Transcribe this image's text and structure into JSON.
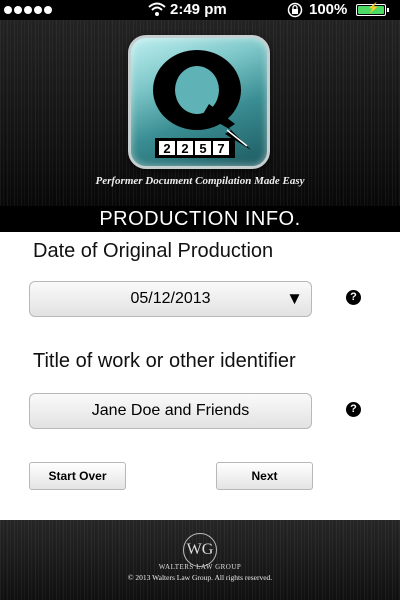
{
  "status_bar": {
    "time": "2:49 pm",
    "battery_percent": "100%",
    "battery_level": 1.0,
    "signal_bars": 5
  },
  "header": {
    "logo": {
      "letter": "Q",
      "counter_digits": [
        "2",
        "2",
        "5",
        "7"
      ]
    },
    "tagline": "Performer Document Compilation Made Easy"
  },
  "section_title": "PRODUCTION INFO.",
  "form": {
    "date_label": "Date of Original Production",
    "date_value": "05/12/2013",
    "dropdown_arrow": "▼",
    "title_label": "Title of work or other identifier",
    "title_value": "Jane Doe and Friends",
    "help_glyph": "?"
  },
  "actions": {
    "start_over_label": "Start Over",
    "next_label": "Next"
  },
  "footer": {
    "emblem_letters": "WG",
    "company": "WALTERS LAW GROUP",
    "copyright": "© 2013 Walters Law Group.  All rights reserved."
  },
  "colors": {
    "accent_teal": "#3a8e93",
    "battery_green": "#4cd964"
  }
}
